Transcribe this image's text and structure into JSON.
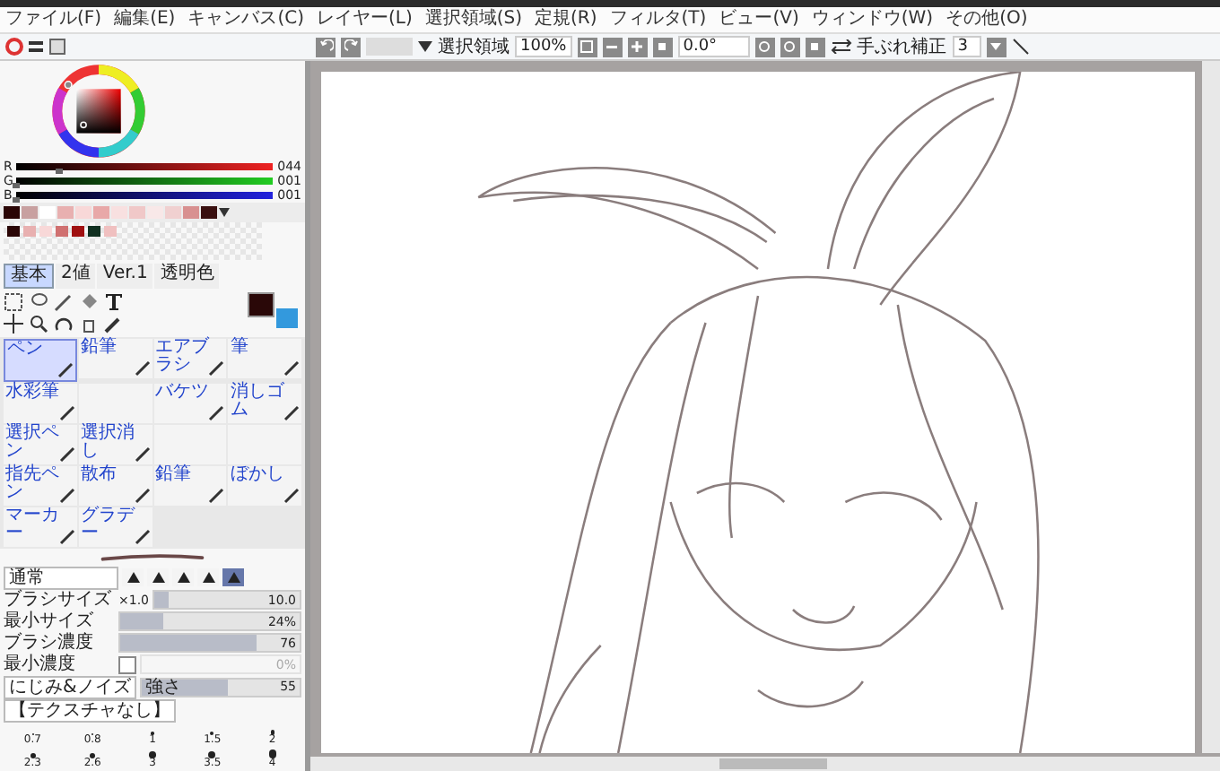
{
  "menu": [
    "ファイル(F)",
    "編集(E)",
    "キャンバス(C)",
    "レイヤー(L)",
    "選択領域(S)",
    "定規(R)",
    "フィルタ(T)",
    "ビュー(V)",
    "ウィンドウ(W)",
    "その他(O)"
  ],
  "toolbar": {
    "selection_label": "選択領域",
    "zoom": "100%",
    "angle": "0.0°",
    "stabilizer_label": "手ぶれ補正",
    "stabilizer": "3"
  },
  "color_sliders": [
    {
      "channel": "R",
      "value": "044",
      "level": 0.17
    },
    {
      "channel": "G",
      "value": "001",
      "level": 0
    },
    {
      "channel": "B",
      "value": "001",
      "level": 0
    }
  ],
  "palette": [
    {
      "color": "#2a0505"
    },
    {
      "color": "#c8a0a0"
    },
    {
      "color": "#ffffff"
    },
    {
      "color": "#e8b0b0"
    },
    {
      "color": "#f8d8d8"
    },
    {
      "color": "#e8a8a8"
    },
    {
      "color": "#f8e0e0"
    },
    {
      "color": "#f0c8c8"
    },
    {
      "color": "#f8e8e8"
    },
    {
      "color": "#f0d0d0"
    },
    {
      "color": "#d89090"
    },
    {
      "color": "#3a1010"
    }
  ],
  "scratch_swatches": [
    {
      "color": "#2a0505"
    },
    {
      "color": "#e8b0b0"
    },
    {
      "color": "#f8d8d8"
    },
    {
      "color": "#d07070"
    },
    {
      "color": "#a01010"
    },
    {
      "color": "#103020"
    },
    {
      "color": "#f0c0c0"
    }
  ],
  "tool_tabs": [
    {
      "label": "基本",
      "selected": true
    },
    {
      "label": "2値",
      "selected": false
    },
    {
      "label": "Ver.1",
      "selected": false
    },
    {
      "label": "透明色",
      "selected": false
    }
  ],
  "current_colors": [
    {
      "color": "#2a0808"
    },
    {
      "color": "#3399dd"
    }
  ],
  "tools": [
    {
      "label": "ペン",
      "selected": true
    },
    {
      "label": "鉛筆",
      "selected": false
    },
    {
      "label": "エアブラシ",
      "selected": false
    },
    {
      "label": "筆",
      "selected": false
    },
    {
      "label": "水彩筆",
      "selected": false
    },
    {
      "selected": false
    },
    {
      "label": "バケツ",
      "selected": false
    },
    {
      "label": "消しゴム",
      "selected": false
    },
    {
      "label": "選択ペン",
      "selected": false
    },
    {
      "label": "選択消し",
      "selected": false
    },
    {
      "selected": false
    },
    {
      "selected": false
    },
    {
      "label": "指先ペン",
      "selected": false
    },
    {
      "label": "散布",
      "selected": false
    },
    {
      "label": "鉛筆",
      "selected": false
    },
    {
      "label": "ぼかし",
      "selected": false
    },
    {
      "label": "マーカー",
      "selected": false
    },
    {
      "label": "グラデー",
      "selected": false
    }
  ],
  "brush": {
    "blend_mode": "通常",
    "shapes": [
      {
        "selected": false
      },
      {
        "selected": false
      },
      {
        "selected": false
      },
      {
        "selected": false
      },
      {
        "selected": true
      }
    ],
    "size": {
      "label": "ブラシサイズ",
      "multiplier": "×1.0",
      "value": "10.0",
      "level": 0.1
    },
    "min_size": {
      "label": "最小サイズ",
      "value": "24%",
      "level": 0.24
    },
    "density": {
      "label": "ブラシ濃度",
      "value": "76",
      "level": 0.76
    },
    "min_density": {
      "label": "最小濃度",
      "checked": false,
      "value": "0%",
      "disabled": true
    },
    "noise": {
      "label": "にじみ&ノイズ",
      "strength_label": "強さ",
      "value": "55",
      "level": 0.55
    },
    "texture": {
      "label": "【テクスチャなし】"
    }
  },
  "size_presets": [
    {
      "value": "0.7",
      "selected": false
    },
    {
      "value": "0.8",
      "selected": false
    },
    {
      "value": "1",
      "selected": false
    },
    {
      "value": "1.5",
      "selected": false
    },
    {
      "value": "2",
      "selected": false
    },
    {
      "value": "2.3",
      "selected": false
    },
    {
      "value": "2.6",
      "selected": false
    },
    {
      "value": "3",
      "selected": false
    },
    {
      "value": "3.5",
      "selected": false
    },
    {
      "value": "4",
      "selected": false
    }
  ]
}
